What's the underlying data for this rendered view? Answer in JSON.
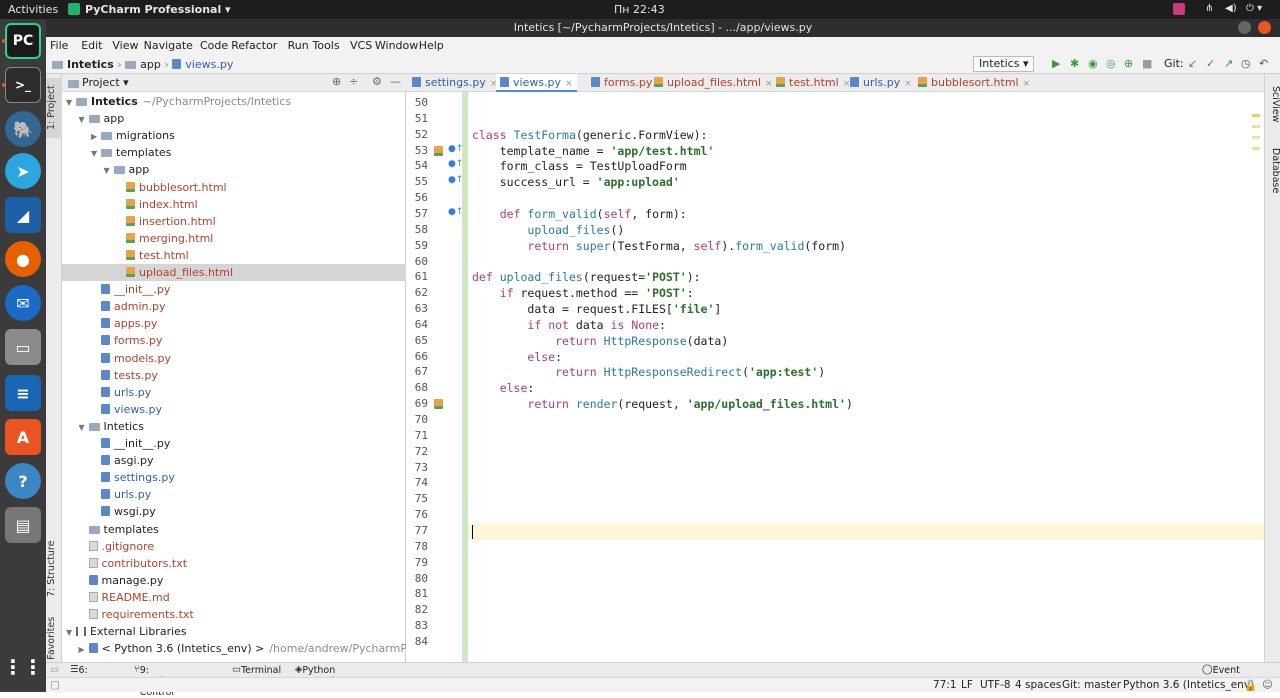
{
  "system": {
    "activities": "Activities",
    "app_menu": "PyCharm Professional ▾",
    "clock": "Пн 22:43"
  },
  "window": {
    "title": "Intetics [~/PycharmProjects/Intetics] - .../app/views.py"
  },
  "menu": [
    "File",
    "Edit",
    "View",
    "Navigate",
    "Code",
    "Refactor",
    "Run",
    "Tools",
    "VCS",
    "Window",
    "Help"
  ],
  "breadcrumb": [
    "Intetics",
    "app",
    "views.py"
  ],
  "toolbar": {
    "run_config": "Intetics ▾",
    "git_label": "Git:"
  },
  "project_panel": {
    "header": "Project ▾",
    "tree": [
      {
        "label": "Intetics",
        "suffix": "~/PycharmProjects/Intetics",
        "kind": "folder",
        "depth": 0,
        "open": true,
        "bold": true
      },
      {
        "label": "app",
        "kind": "folder",
        "depth": 1,
        "open": true
      },
      {
        "label": "migrations",
        "kind": "folder",
        "depth": 2,
        "open": false
      },
      {
        "label": "templates",
        "kind": "folder",
        "depth": 2,
        "open": true
      },
      {
        "label": "app",
        "kind": "folder",
        "depth": 3,
        "open": true
      },
      {
        "label": "bubblesort.html",
        "kind": "html",
        "depth": 4,
        "color": "red"
      },
      {
        "label": "index.html",
        "kind": "html",
        "depth": 4,
        "color": "red"
      },
      {
        "label": "insertion.html",
        "kind": "html",
        "depth": 4,
        "color": "red"
      },
      {
        "label": "merging.html",
        "kind": "html",
        "depth": 4,
        "color": "red"
      },
      {
        "label": "test.html",
        "kind": "html",
        "depth": 4,
        "color": "red"
      },
      {
        "label": "upload_files.html",
        "kind": "html",
        "depth": 4,
        "color": "red",
        "selected": true
      },
      {
        "label": "__init__.py",
        "kind": "py",
        "depth": 2,
        "color": "red"
      },
      {
        "label": "admin.py",
        "kind": "py",
        "depth": 2,
        "color": "red"
      },
      {
        "label": "apps.py",
        "kind": "py",
        "depth": 2,
        "color": "red"
      },
      {
        "label": "forms.py",
        "kind": "py",
        "depth": 2,
        "color": "red"
      },
      {
        "label": "models.py",
        "kind": "py",
        "depth": 2,
        "color": "red"
      },
      {
        "label": "tests.py",
        "kind": "py",
        "depth": 2,
        "color": "red"
      },
      {
        "label": "urls.py",
        "kind": "py",
        "depth": 2,
        "color": "blue"
      },
      {
        "label": "views.py",
        "kind": "py",
        "depth": 2,
        "color": "blue"
      },
      {
        "label": "Intetics",
        "kind": "folder",
        "depth": 1,
        "open": true
      },
      {
        "label": "__init__.py",
        "kind": "py",
        "depth": 2
      },
      {
        "label": "asgi.py",
        "kind": "py",
        "depth": 2
      },
      {
        "label": "settings.py",
        "kind": "py",
        "depth": 2,
        "color": "blue"
      },
      {
        "label": "urls.py",
        "kind": "py",
        "depth": 2,
        "color": "blue"
      },
      {
        "label": "wsgi.py",
        "kind": "py",
        "depth": 2
      },
      {
        "label": "templates",
        "kind": "folder",
        "depth": 1
      },
      {
        "label": ".gitignore",
        "kind": "txt",
        "depth": 1,
        "color": "red"
      },
      {
        "label": "contributors.txt",
        "kind": "txt",
        "depth": 1,
        "color": "red"
      },
      {
        "label": "manage.py",
        "kind": "py",
        "depth": 1
      },
      {
        "label": "README.md",
        "kind": "txt",
        "depth": 1,
        "color": "red"
      },
      {
        "label": "requirements.txt",
        "kind": "txt",
        "depth": 1,
        "color": "red"
      },
      {
        "label": "External Libraries",
        "kind": "lib",
        "depth": 0,
        "open": true
      },
      {
        "label": "< Python 3.6 (Intetics_env) >",
        "suffix": "/home/andrew/PycharmProjects/In",
        "kind": "py",
        "depth": 1,
        "open": false
      }
    ]
  },
  "tabs": [
    {
      "label": "settings.py",
      "kind": "py"
    },
    {
      "label": "views.py",
      "kind": "py",
      "active": true
    },
    {
      "label": "forms.py",
      "kind": "py",
      "color": "red"
    },
    {
      "label": "upload_files.html",
      "kind": "html",
      "color": "red"
    },
    {
      "label": "test.html",
      "kind": "html",
      "color": "red"
    },
    {
      "label": "urls.py",
      "kind": "py"
    },
    {
      "label": "bubblesort.html",
      "kind": "html",
      "color": "red"
    }
  ],
  "editor": {
    "first_line": 50,
    "caret_line": 77,
    "lines": [
      "",
      "",
      "class TestForma(generic.FormView):",
      "    template_name = 'app/test.html'",
      "    form_class = TestUploadForm",
      "    success_url = 'app:upload'",
      "",
      "    def form_valid(self, form):",
      "        upload_files()",
      "        return super(TestForma, self).form_valid(form)",
      "",
      "def upload_files(request='POST'):",
      "    if request.method == 'POST':",
      "        data = request.FILES['file']",
      "        if not data is None:",
      "            return HttpResponse(data)",
      "        else:",
      "            return HttpResponseRedirect('app:test')",
      "    else:",
      "        return render(request, 'app/upload_files.html')",
      "",
      "",
      "",
      "",
      "",
      "",
      "",
      "",
      "",
      "",
      "",
      "",
      "",
      "",
      ""
    ]
  },
  "side_tools": {
    "left": [
      "1: Project",
      "7: Structure",
      "2: Favorites"
    ],
    "right": [
      "SciView",
      "Database"
    ]
  },
  "bottom_tools": [
    "6: TODO",
    "9: Version Control",
    "Terminal",
    "Python Console"
  ],
  "event_log": "Event Log",
  "status": {
    "position": "77:1",
    "line_sep": "LF",
    "encoding": "UTF-8",
    "indent": "4 spaces",
    "git": "Git: master",
    "interpreter": "Python 3.6 (Intetics_env)"
  }
}
